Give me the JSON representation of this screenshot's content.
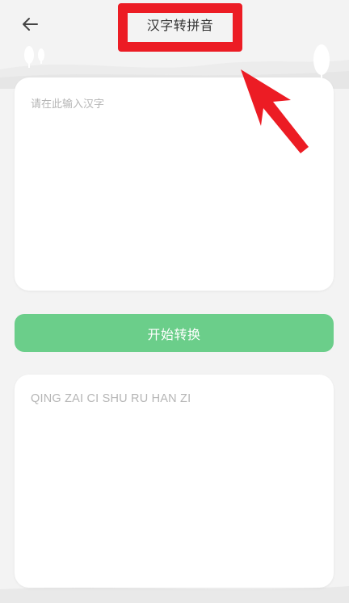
{
  "header": {
    "back_icon": "arrow-left-icon",
    "title": "汉字转拼音"
  },
  "annotation": {
    "box_color": "#ec1c24",
    "arrow_color": "#ec1c24"
  },
  "input": {
    "placeholder": "请在此输入汉字",
    "value": ""
  },
  "convert_button": {
    "label": "开始转换",
    "color": "#6bce8a"
  },
  "output": {
    "text": "QING ZAI CI SHU RU HAN ZI"
  }
}
